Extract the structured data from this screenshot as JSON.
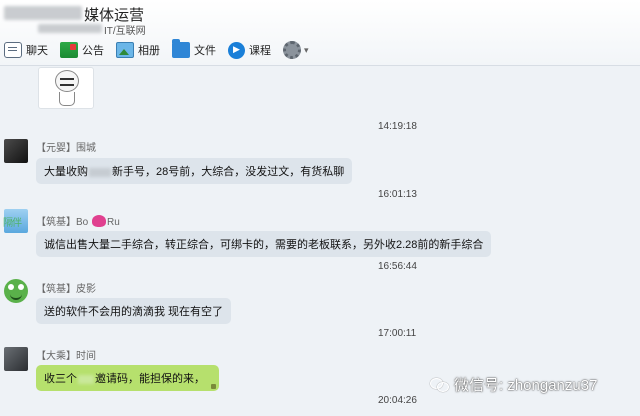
{
  "header": {
    "group_name": "媒体运营",
    "group_sub": "IT/互联网"
  },
  "toolbar": {
    "items": [
      {
        "label": "聊天",
        "icon": "chat-icon"
      },
      {
        "label": "公告",
        "icon": "notice-icon"
      },
      {
        "label": "相册",
        "icon": "album-icon"
      },
      {
        "label": "文件",
        "icon": "folder-icon"
      },
      {
        "label": "课程",
        "icon": "course-icon"
      }
    ],
    "settings_icon": "gear-icon"
  },
  "messages": [
    {
      "time": "14:19:18"
    },
    {
      "tag": "【元婴】",
      "name": "围城",
      "text_a": "大量收购",
      "text_b": "新手号，28号前，大综合，没发过文，有货私聊",
      "time": "16:01:13"
    },
    {
      "tag": "【筑基】",
      "name": "Bo",
      "name_b": "Ru",
      "text": "诚信出售大量二手综合，转正综合，可绑卡的，需要的老板联系，另外收2.28前的新手综合",
      "time": "16:56:44"
    },
    {
      "tag": "【筑基】",
      "name": "皮影",
      "text": "送的软件不会用的滴滴我 现在有空了",
      "time": "17:00:11"
    },
    {
      "tag": "【大乘】",
      "name": "时间",
      "text_a": "收三个",
      "text_b": "邀请码，能担保的来，",
      "time": "20:04:26"
    }
  ],
  "watermark": "微信号: zhonganzu37",
  "colors": {
    "bubble": "#dde4eb",
    "bubble_own": "#b6e06d",
    "background": "#eef2f6"
  }
}
